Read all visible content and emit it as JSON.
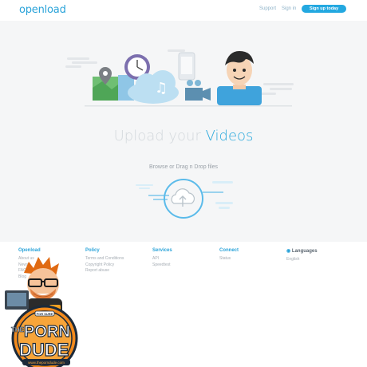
{
  "header": {
    "logo": "openload",
    "nav": {
      "support": "Support",
      "signin": "Sign in",
      "signup": "Sign up today"
    }
  },
  "main": {
    "title_part1": "Upload your",
    "title_part2": "Videos",
    "browse": "Browse or Drag n Drop files"
  },
  "footer": {
    "columns": [
      {
        "heading": "Openload",
        "links": [
          "About us",
          "News",
          "FAQ",
          "Blog"
        ]
      },
      {
        "heading": "Policy",
        "links": [
          "Terms and Conditions",
          "Copyright Policy",
          "Report abuse"
        ]
      },
      {
        "heading": "Services",
        "links": [
          "API",
          "Speedtest"
        ]
      },
      {
        "heading": "Connect",
        "links": [
          "Status"
        ]
      },
      {
        "heading": "Languages",
        "links": [
          "English"
        ]
      }
    ]
  },
  "badge": {
    "name_the": "THE",
    "name_porn": "PORN",
    "name_dude": "DUDE",
    "url": "www.theporndude.com",
    "sash": "FOR SURE"
  },
  "colors": {
    "accent": "#2aa3d9",
    "signup": "#23a8e0",
    "background_main": "#f5f6f7",
    "badge_orange": "#f28a1c",
    "badge_dark": "#1c2a3a"
  }
}
